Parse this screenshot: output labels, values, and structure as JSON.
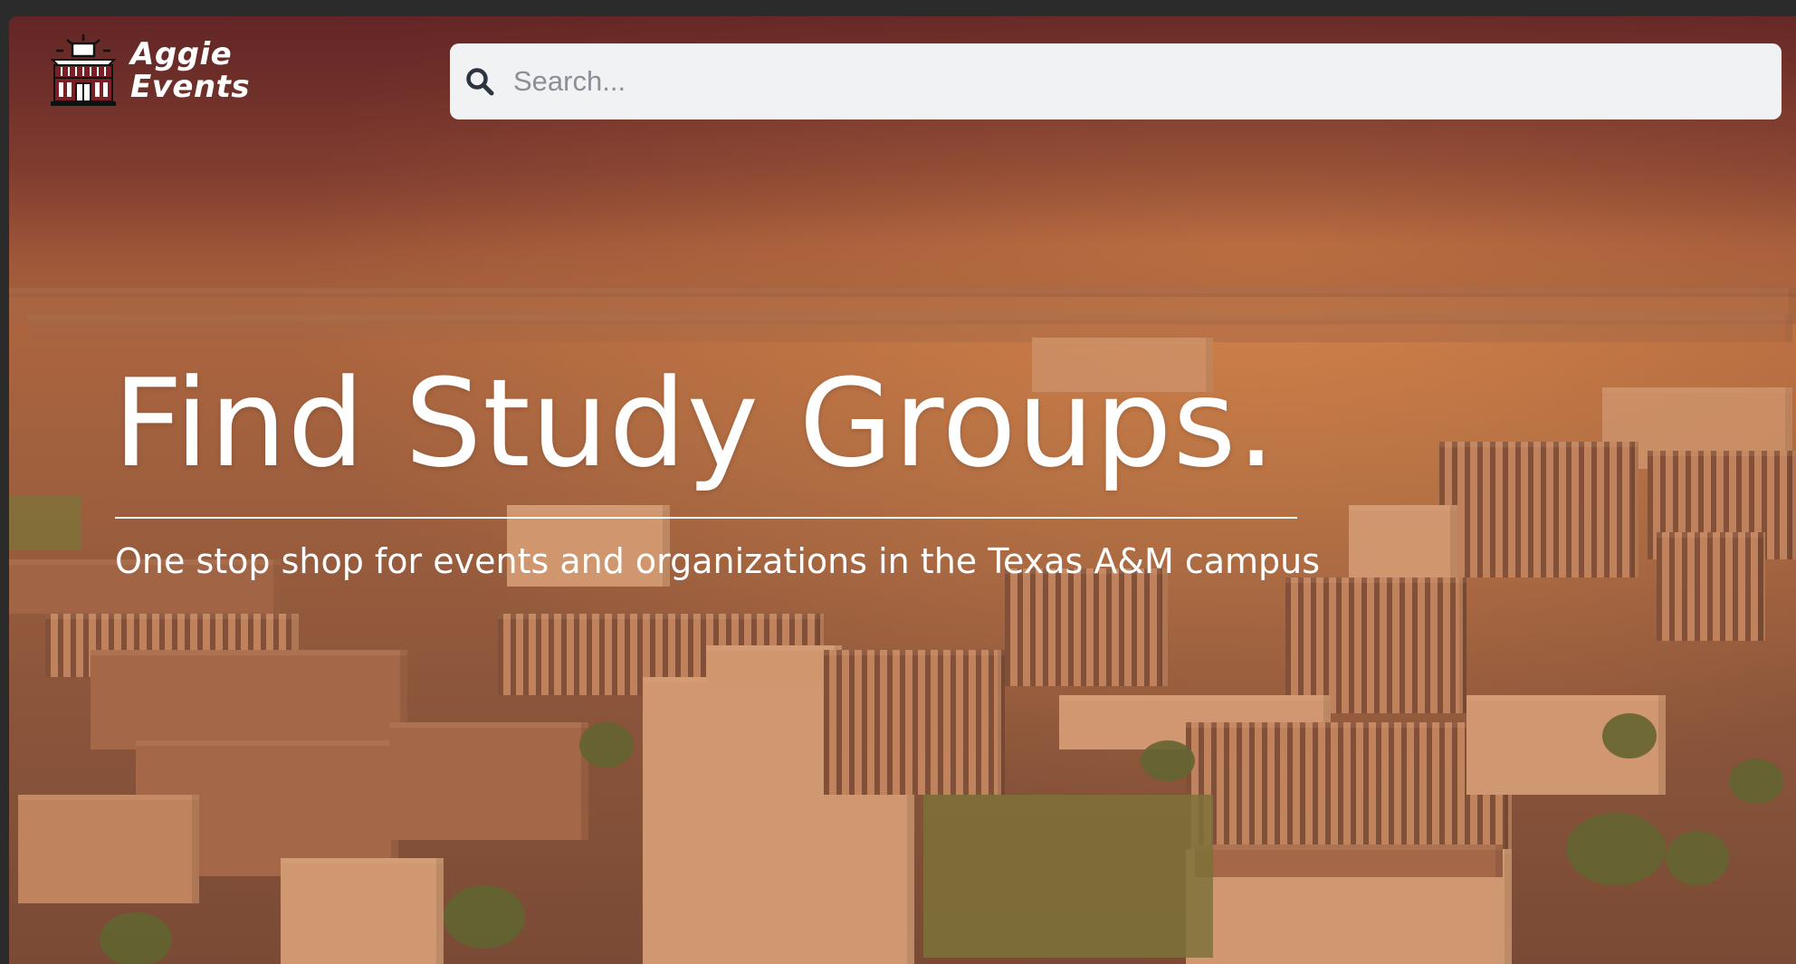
{
  "brand": {
    "name_line1": "Aggie",
    "name_line2": "Events",
    "logo_icon": "academic-building-icon"
  },
  "search": {
    "placeholder": "Search...",
    "value": "",
    "icon": "search-icon"
  },
  "hero": {
    "title": "Find Study Groups.",
    "subtitle": "One stop shop for events and organizations in the Texas A&M campus"
  },
  "colors": {
    "maroon": "#6e2c2c",
    "search_bg": "#f1f2f4",
    "text_on_hero": "#ffffff",
    "search_icon": "#2c3440"
  }
}
